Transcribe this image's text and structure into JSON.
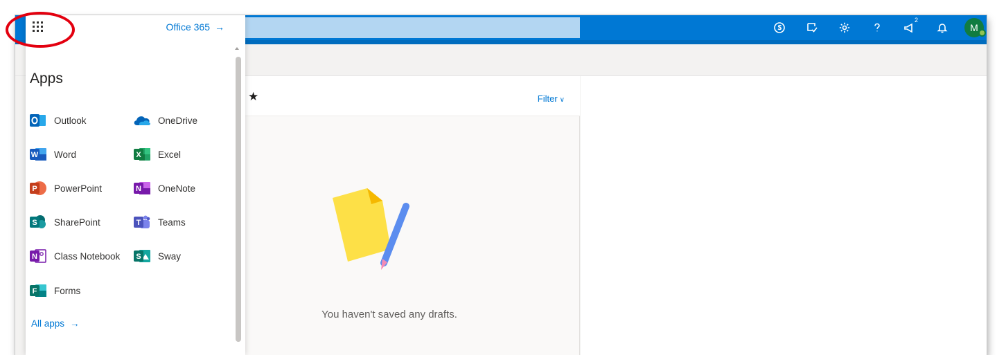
{
  "launcher": {
    "office365_label": "Office 365",
    "office365_arrow": "→",
    "apps_title": "Apps",
    "all_apps_label": "All apps",
    "all_apps_arrow": "→",
    "apps": [
      {
        "label": "Outlook",
        "icon": "outlook-icon"
      },
      {
        "label": "OneDrive",
        "icon": "onedrive-icon"
      },
      {
        "label": "Word",
        "icon": "word-icon"
      },
      {
        "label": "Excel",
        "icon": "excel-icon"
      },
      {
        "label": "PowerPoint",
        "icon": "powerpoint-icon"
      },
      {
        "label": "OneNote",
        "icon": "onenote-icon"
      },
      {
        "label": "SharePoint",
        "icon": "sharepoint-icon"
      },
      {
        "label": "Teams",
        "icon": "teams-icon"
      },
      {
        "label": "Class Notebook",
        "icon": "class-notebook-icon"
      },
      {
        "label": "Sway",
        "icon": "sway-icon"
      },
      {
        "label": "Forms",
        "icon": "forms-icon"
      }
    ]
  },
  "topbar": {
    "notification_badge": "2",
    "avatar_initial": "M",
    "icons": [
      "skype-icon",
      "todo-icon",
      "gear-icon",
      "help-icon",
      "megaphone-icon",
      "bell-icon"
    ]
  },
  "list": {
    "favorite_icon": "★",
    "filter_label": "Filter",
    "filter_chevron": "∨",
    "empty_message": "You haven't saved any drafts."
  },
  "colors": {
    "brand_blue": "#0078d4",
    "search_bg": "#b3d6f2",
    "annotation_red": "#e3000f"
  }
}
